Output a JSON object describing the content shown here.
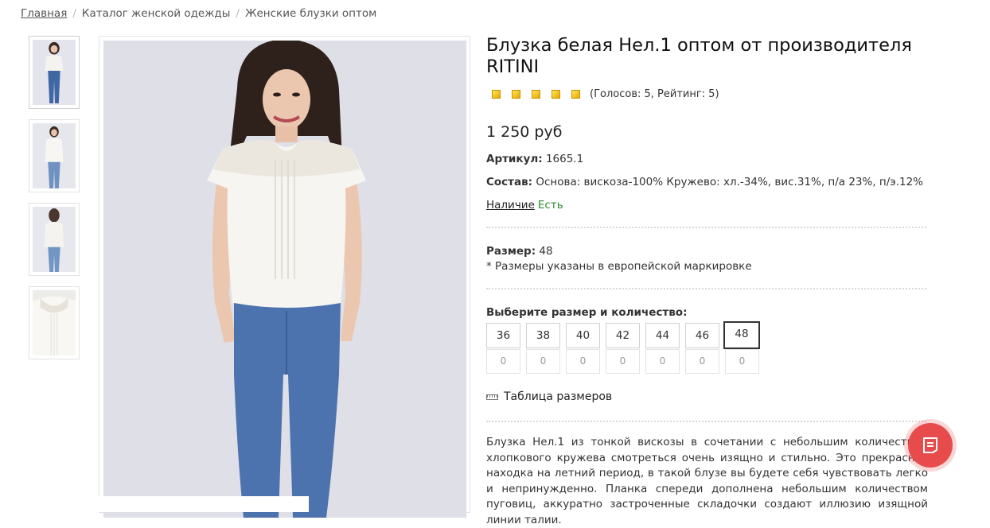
{
  "breadcrumb": {
    "home": "Главная",
    "catalog": "Каталог женской одежды",
    "current": "Женские блузки оптом"
  },
  "product": {
    "title": "Блузка белая Нел.1 оптом от производителя RITINI",
    "rating_text": "(Голосов: 5, Рейтинг: 5)",
    "stars": 5,
    "price": "1 250 руб",
    "article_label": "Артикул:",
    "article_value": "1665.1",
    "composition_label": "Состав:",
    "composition_value": "Основа: вискоза-100% Кружево: хл.-34%, вис.31%, п/а 23%, п/э.12%",
    "availability_label": "Наличие",
    "availability_value": "Есть",
    "size_label": "Размер:",
    "size_value": "48",
    "size_note": "* Размеры указаны в европейской маркировке",
    "choose_label": "Выберите размер и количество:",
    "sizes": [
      "36",
      "38",
      "40",
      "42",
      "44",
      "46",
      "48"
    ],
    "selected_size": "48",
    "quantities": [
      "0",
      "0",
      "0",
      "0",
      "0",
      "0",
      "0"
    ],
    "size_table_link": "Таблица размеров",
    "description": "Блузка Нел.1 из тонкой вискозы в сочетании с небольшим количеством хлопкового кружева смотреться очень изящно и стильно. Это прекрасная находка на летний период, в такой блузе вы будете себя чувствовать легко и непринужденно. Планка спереди дополнена небольшим количеством пуговиц, аккуратно застроченные складочки создают иллюзию изящной линии талии."
  },
  "colors": {
    "accent": "#e84b4b",
    "available": "#2e8b2e",
    "star": "#f2c200"
  },
  "icons": {
    "fab": "chat-menu-icon",
    "size_table": "ruler-icon"
  }
}
